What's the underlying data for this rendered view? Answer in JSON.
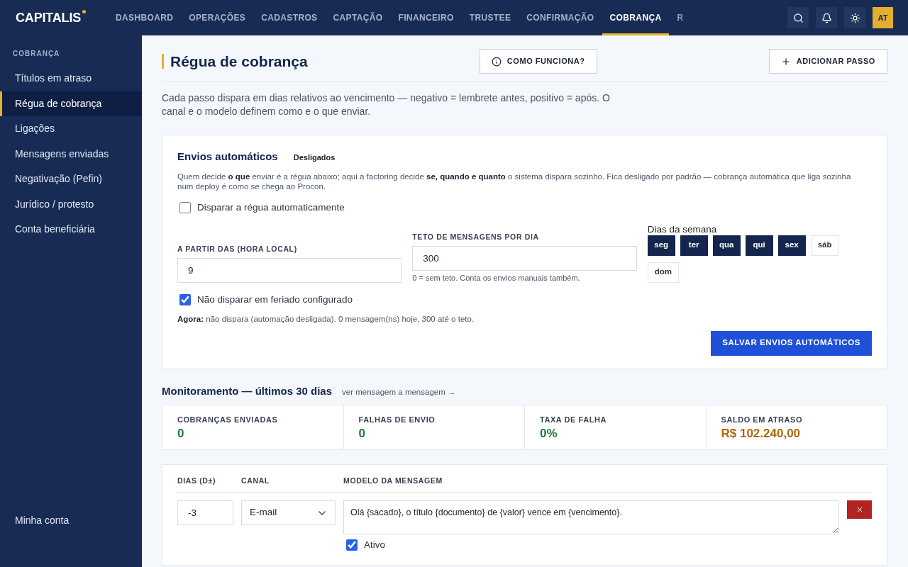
{
  "app": {
    "logo": "CAPITALIS",
    "user_initials": "AT"
  },
  "nav": [
    {
      "label": "DASHBOARD",
      "selected": false
    },
    {
      "label": "OPERAÇÕES",
      "selected": false
    },
    {
      "label": "CADASTROS",
      "selected": false
    },
    {
      "label": "CAPTAÇÃO",
      "selected": false
    },
    {
      "label": "FINANCEIRO",
      "selected": false
    },
    {
      "label": "TRUSTEE",
      "selected": false
    },
    {
      "label": "CONFIRMAÇÃO",
      "selected": false
    },
    {
      "label": "COBRANÇA",
      "selected": true
    },
    {
      "label": "R",
      "selected": false
    }
  ],
  "sidebar": {
    "section": "COBRANÇA",
    "items": [
      {
        "label": "Títulos em atraso",
        "selected": false
      },
      {
        "label": "Régua de cobrança",
        "selected": true
      },
      {
        "label": "Ligações",
        "selected": false
      },
      {
        "label": "Mensagens enviadas",
        "selected": false
      },
      {
        "label": "Negativação (Pefin)",
        "selected": false
      },
      {
        "label": "Jurídico / protesto",
        "selected": false
      },
      {
        "label": "Conta beneficiária",
        "selected": false
      }
    ],
    "footer": "Minha conta"
  },
  "header": {
    "title": "Régua de cobrança",
    "buttons": [
      {
        "kind": "info",
        "label": "COMO FUNCIONA?"
      },
      {
        "kind": "add",
        "label": "ADICIONAR PASSO"
      }
    ],
    "description": "Cada passo dispara em dias relativos ao vencimento — negativo = lembrete antes, positivo = após. O canal e o modelo definem como e o que enviar."
  },
  "auto": {
    "title": "Envios automáticos",
    "status": "Desligados",
    "description": "Quem decide **o que** enviar é a régua abaixo; aqui a factoring decide **se, quando e quanto** o sistema dispara sozinho. Fica desligado por padrão — cobrança automática que liga sozinha num deploy é como se chega ao Procon.",
    "enable": {
      "label": "Disparar a régua automaticamente",
      "checked": false
    },
    "start": {
      "label": "A PARTIR DAS (HORA LOCAL)",
      "value": "9"
    },
    "cap": {
      "label": "TETO DE MENSAGENS POR DIA",
      "value": "300",
      "hint": "0 = sem teto. Conta os envios manuais também."
    },
    "days": {
      "label": "Dias da semana",
      "items": [
        {
          "label": "seg",
          "selected": true
        },
        {
          "label": "ter",
          "selected": true
        },
        {
          "label": "qua",
          "selected": true
        },
        {
          "label": "qui",
          "selected": true
        },
        {
          "label": "sex",
          "selected": true
        },
        {
          "label": "sáb",
          "selected": false
        },
        {
          "label": "dom",
          "selected": false
        }
      ]
    },
    "holiday": {
      "label": "Não disparar em feriado configurado",
      "checked": true
    },
    "now": "**Agora:** não dispara (automação desligada). 0 mensagem(ns) hoje, 300 até o teto.",
    "save": "SALVAR ENVIOS AUTOMÁTICOS"
  },
  "monitoring": {
    "title": "Monitoramento — últimos 30 dias",
    "link": "ver mensagem a mensagem →",
    "stats": [
      {
        "label": "COBRANÇAS ENVIADAS",
        "value": "0",
        "color": "#1e7a3e"
      },
      {
        "label": "FALHAS DE ENVIO",
        "value": "0",
        "color": "#1e7a3e"
      },
      {
        "label": "TAXA DE FALHA",
        "value": "0%",
        "color": "#1e7a3e"
      },
      {
        "label": "SALDO EM ATRASO",
        "value": "R$ 102.240,00",
        "color": "#b0670c"
      }
    ]
  },
  "steps": {
    "columns": [
      "DIAS (D±)",
      "CANAL",
      "MODELO DA MENSAGEM"
    ],
    "rows": [
      {
        "days": "-3",
        "channel": "E-mail",
        "template": "Olá {sacado}, o título {documento} de {valor} vence em {vencimento}.",
        "active": {
          "label": "Ativo",
          "checked": true
        }
      }
    ]
  }
}
